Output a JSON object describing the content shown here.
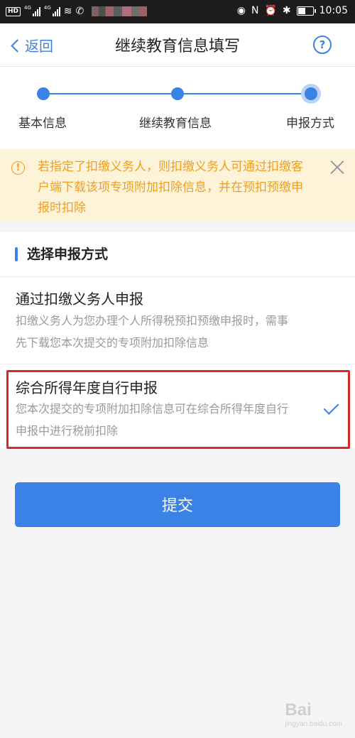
{
  "status_bar": {
    "network_a": "4G",
    "network_b": "4G",
    "time": "10:05",
    "battery_percent": 55
  },
  "nav": {
    "back_label": "返回",
    "title": "继续教育信息填写",
    "help_glyph": "?"
  },
  "stepper": {
    "steps": [
      {
        "label": "基本信息"
      },
      {
        "label": "继续教育信息"
      },
      {
        "label": "申报方式"
      }
    ],
    "active_index": 2
  },
  "notice": {
    "icon": "warning-icon",
    "text": "若指定了扣缴义务人，则扣缴义务人可通过扣缴客户端下载该项专项附加扣除信息，并在预扣预缴申报时扣除"
  },
  "section": {
    "title": "选择申报方式"
  },
  "options": [
    {
      "title": "通过扣缴义务人申报",
      "description": "扣缴义务人为您办理个人所得税预扣预缴申报时，需事先下载您本次提交的专项附加扣除信息",
      "selected": false
    },
    {
      "title": "综合所得年度自行申报",
      "description": "您本次提交的专项附加扣除信息可在综合所得年度自行申报中进行税前扣除",
      "selected": true
    }
  ],
  "submit": {
    "label": "提交"
  },
  "watermark": {
    "text": "Bai",
    "subtext": "jingyan.baidu.com"
  },
  "colors": {
    "accent": "#3b82e6",
    "notice_bg": "#fdf3d8",
    "notice_text": "#f0a020",
    "highlight": "#d42a2a"
  }
}
